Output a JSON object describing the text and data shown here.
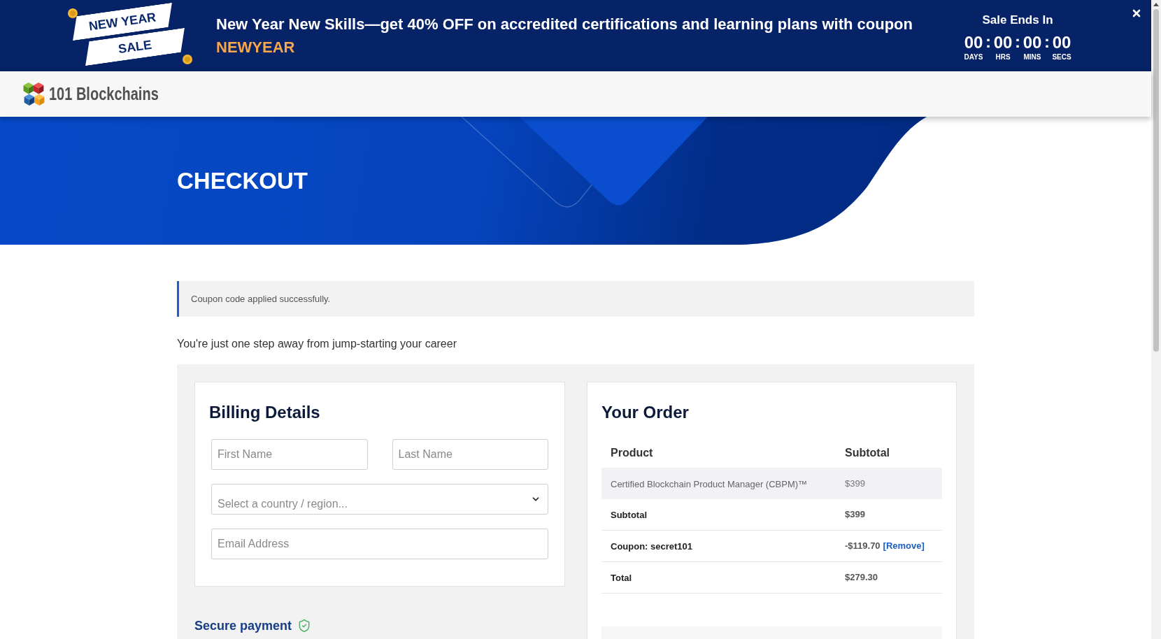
{
  "promo_banner": {
    "ribbon": [
      "NEW YEAR",
      "SALE"
    ],
    "headline": "New Year New Skills—get 40% OFF on accredited certifications and learning plans with coupon",
    "coupon_code": "NEWYEAR",
    "countdown": {
      "title": "Sale Ends In",
      "units": [
        {
          "value": "00",
          "label": "DAYS",
          "separator": ":"
        },
        {
          "value": "00",
          "label": "HRS",
          "separator": ":"
        },
        {
          "value": "00",
          "label": "MINS",
          "separator": ":"
        },
        {
          "value": "00",
          "label": "SECS"
        }
      ]
    }
  },
  "header": {
    "logo_text": "101 Blockchains"
  },
  "hero": {
    "title": "CHECKOUT"
  },
  "notice": {
    "message": "Coupon code applied successfully."
  },
  "tagline": "You're just one step away from jump-starting your career",
  "billing": {
    "title": "Billing Details",
    "fields": [
      {
        "kind": "name",
        "placeholder": "First Name"
      },
      {
        "kind": "name",
        "placeholder": "Last Name"
      },
      {
        "kind": "select",
        "placeholder": "Select a country / region..."
      },
      {
        "kind": "email",
        "placeholder": "Email Address"
      }
    ]
  },
  "secure_payment": {
    "label": "Secure payment"
  },
  "order": {
    "title": "Your Order",
    "columns": [
      "Product",
      "Subtotal"
    ],
    "rows": [
      {
        "kind": "item",
        "label": "Certified Blockchain Product Manager (CBPM)™",
        "value": "$399"
      },
      {
        "kind": "total",
        "label": "Subtotal",
        "value": "$399"
      },
      {
        "kind": "total",
        "label": "Coupon: secret101",
        "value": "-$119.70",
        "link": "[Remove]"
      },
      {
        "kind": "total",
        "label": "Total",
        "value": "$279.30"
      }
    ]
  }
}
